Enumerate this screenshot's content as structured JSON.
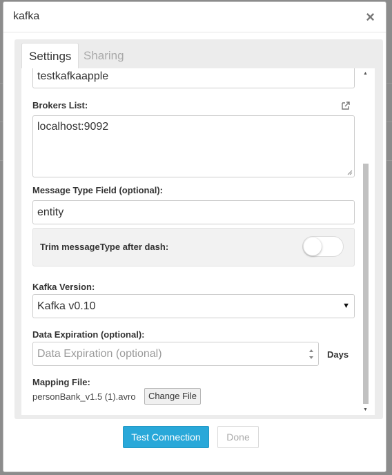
{
  "modal": {
    "title": "kafka",
    "close_glyph": "×"
  },
  "tabs": [
    {
      "label": "Settings",
      "active": true
    },
    {
      "label": "Sharing",
      "active": false
    }
  ],
  "form": {
    "name_value": "testkafkaapple",
    "brokers_label": "Brokers List:",
    "brokers_value": "localhost:9092",
    "message_type_label": "Message Type Field (optional):",
    "message_type_value": "entity",
    "trim_label": "Trim messageType after dash:",
    "trim_enabled": false,
    "kafka_version_label": "Kafka Version:",
    "kafka_version_value": "Kafka v0.10",
    "expiration_label": "Data Expiration (optional):",
    "expiration_placeholder": "Data Expiration (optional)",
    "days_label": "Days",
    "mapping_label": "Mapping File:",
    "mapping_file_name": "personBank_v1.5 (1).avro",
    "change_file_label": "Change File"
  },
  "footer": {
    "test_connection_label": "Test Connection",
    "done_label": "Done"
  },
  "colors": {
    "primary": "#29a8d9",
    "panel_bg": "#ececec",
    "muted_text": "#a9a9a9"
  },
  "icons": {
    "expand": "external-link-icon",
    "close": "close-icon",
    "select_arrow": "caret-down-icon",
    "spinner": "number-spinner-icon"
  }
}
